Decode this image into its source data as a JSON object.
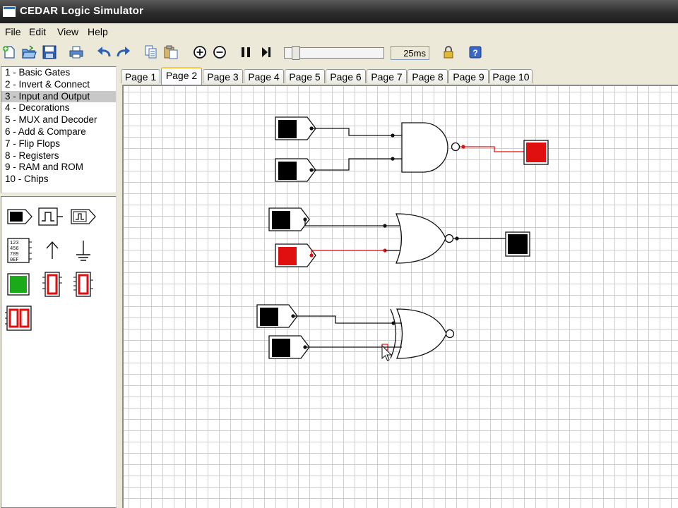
{
  "window": {
    "title": "CEDAR Logic Simulator"
  },
  "menu": {
    "items": [
      "File",
      "Edit",
      "View",
      "Help"
    ]
  },
  "toolbar": {
    "icons": [
      "new-file-icon",
      "open-file-icon",
      "save-icon",
      "print-icon",
      "undo-icon",
      "redo-icon",
      "copy-icon",
      "paste-icon",
      "zoom-in-icon",
      "zoom-out-icon",
      "pause-icon",
      "step-icon",
      "lock-icon",
      "help-icon"
    ],
    "speed_value": "25ms",
    "speed_level": 0.08
  },
  "library": {
    "items": [
      "1  - Basic Gates",
      "2  - Invert & Connect",
      "3  - Input and Output",
      "4  - Decorations",
      "5  - MUX and Decoder",
      "6  - Add & Compare",
      "7  - Flip Flops",
      "8  - Registers",
      "9  - RAM and ROM",
      "10 - Chips"
    ],
    "selected_index": 2
  },
  "parts": [
    "toggle-switch-part",
    "clock-part",
    "pulse-part",
    "hex-keypad-part",
    "vcc-part",
    "ground-part",
    "led-part",
    "seven-segment-part",
    "seven-segment-bus-part",
    "dual-seven-segment-part"
  ],
  "tabs": {
    "labels": [
      "Page 1",
      "Page 2",
      "Page 3",
      "Page 4",
      "Page 5",
      "Page 6",
      "Page 7",
      "Page 8",
      "Page 9",
      "Page 10"
    ],
    "active_index": 1
  },
  "colors": {
    "signal_high": "#e01010",
    "signal_low": "#000000",
    "led_green": "#1aaa1a",
    "active_tab_accent": "#ffc83c"
  }
}
